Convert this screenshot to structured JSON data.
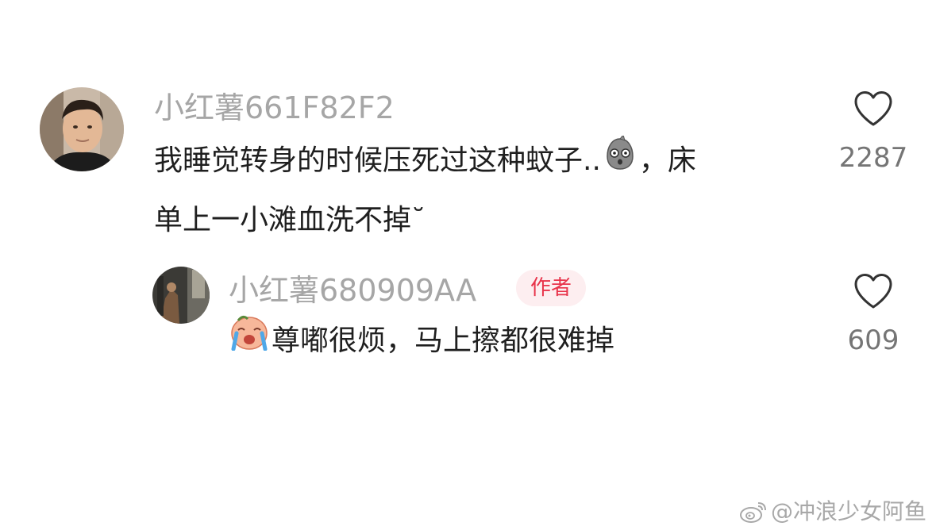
{
  "comments": [
    {
      "username": "小红薯661F82F2",
      "text_part1": "我睡觉转身的时候压死过这种蚊子..",
      "text_part2": "，床",
      "text_line2": "单上一小滩血洗不掉˘",
      "emoji_icon": "shocked-blob-icon",
      "likes": "2287",
      "avatar_icon": "male-avatar"
    }
  ],
  "replies": [
    {
      "username": "小红薯680909AA",
      "badge": "作者",
      "text": "尊嘟很烦，马上擦都很难掉",
      "emoji_icon": "crying-face-icon",
      "likes": "609",
      "avatar_icon": "dark-photo-avatar"
    }
  ],
  "watermark": {
    "text": "@冲浪少女阿鱼",
    "icon": "weibo-icon"
  },
  "colors": {
    "username": "#a6a6a6",
    "badge_bg": "#fdeef0",
    "badge_text": "#e8334a",
    "like_count": "#757575"
  }
}
